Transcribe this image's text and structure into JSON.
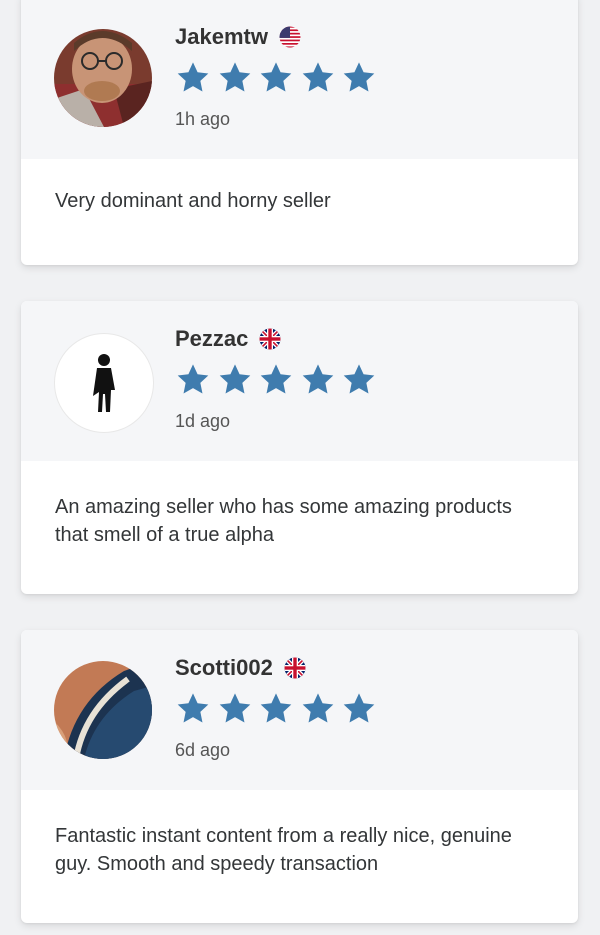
{
  "colors": {
    "star": "#3f7cae",
    "card_header_bg": "#f5f6f8",
    "page_bg": "#f0f1f3"
  },
  "reviews": [
    {
      "username": "Jakemtw",
      "flag": "us-flag-icon",
      "rating": 5,
      "time_ago": "1h ago",
      "avatar": "photo-avatar",
      "text": "Very dominant and horny seller"
    },
    {
      "username": "Pezzac",
      "flag": "uk-flag-icon",
      "rating": 5,
      "time_ago": "1d ago",
      "avatar": "default-person-avatar",
      "text": "An amazing seller who has some amazing products that smell of a true alpha"
    },
    {
      "username": "Scotti002",
      "flag": "uk-flag-icon",
      "rating": 5,
      "time_ago": "6d ago",
      "avatar": "photo-avatar",
      "text": "Fantastic instant content from a really nice, genuine guy. Smooth and speedy transaction"
    }
  ]
}
